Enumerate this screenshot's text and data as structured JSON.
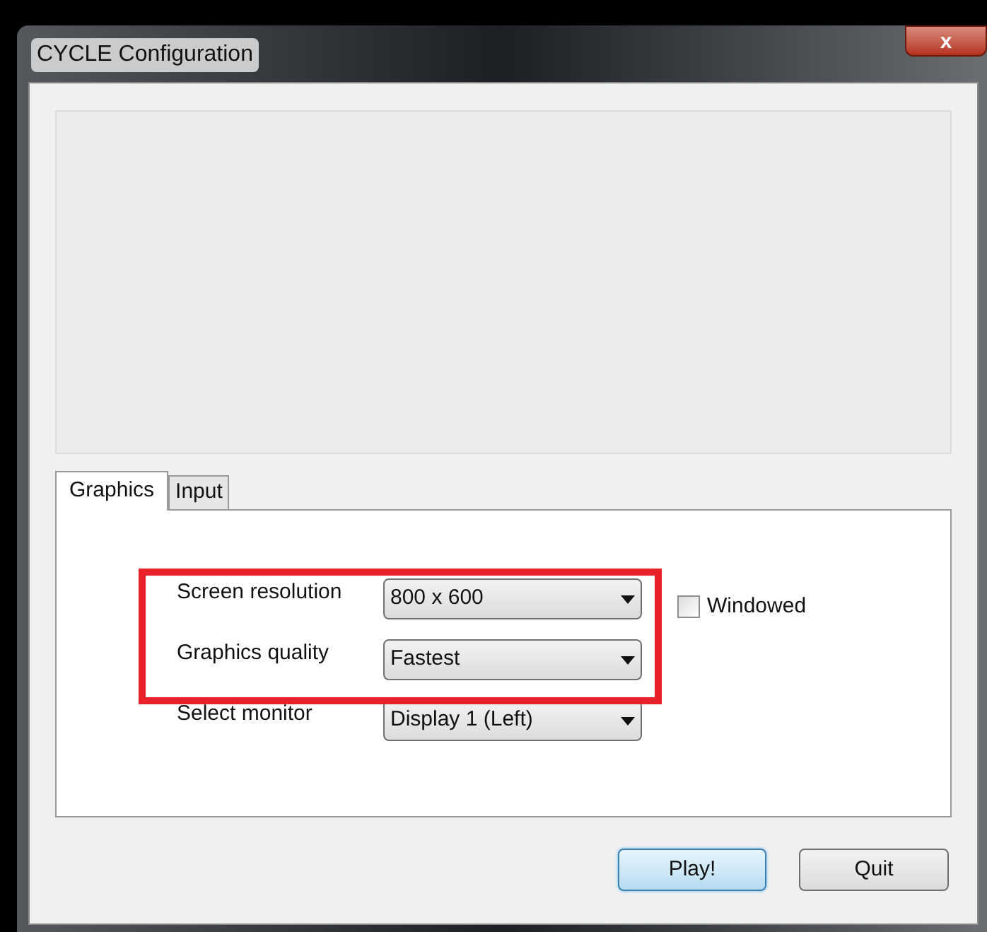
{
  "window": {
    "title": "CYCLE Configuration",
    "close": "x"
  },
  "tabs": [
    {
      "label": "Graphics",
      "selected": true
    },
    {
      "label": "Input",
      "selected": false
    }
  ],
  "settings": [
    {
      "label": "Screen resolution",
      "value": "800 x 600"
    },
    {
      "label": "Graphics quality",
      "value": "Fastest"
    },
    {
      "label": "Select monitor",
      "value": "Display 1 (Left)"
    }
  ],
  "windowed": {
    "label": "Windowed",
    "checked": false
  },
  "buttons": [
    {
      "label": "Play!",
      "default": true
    },
    {
      "label": "Quit",
      "default": false
    }
  ]
}
